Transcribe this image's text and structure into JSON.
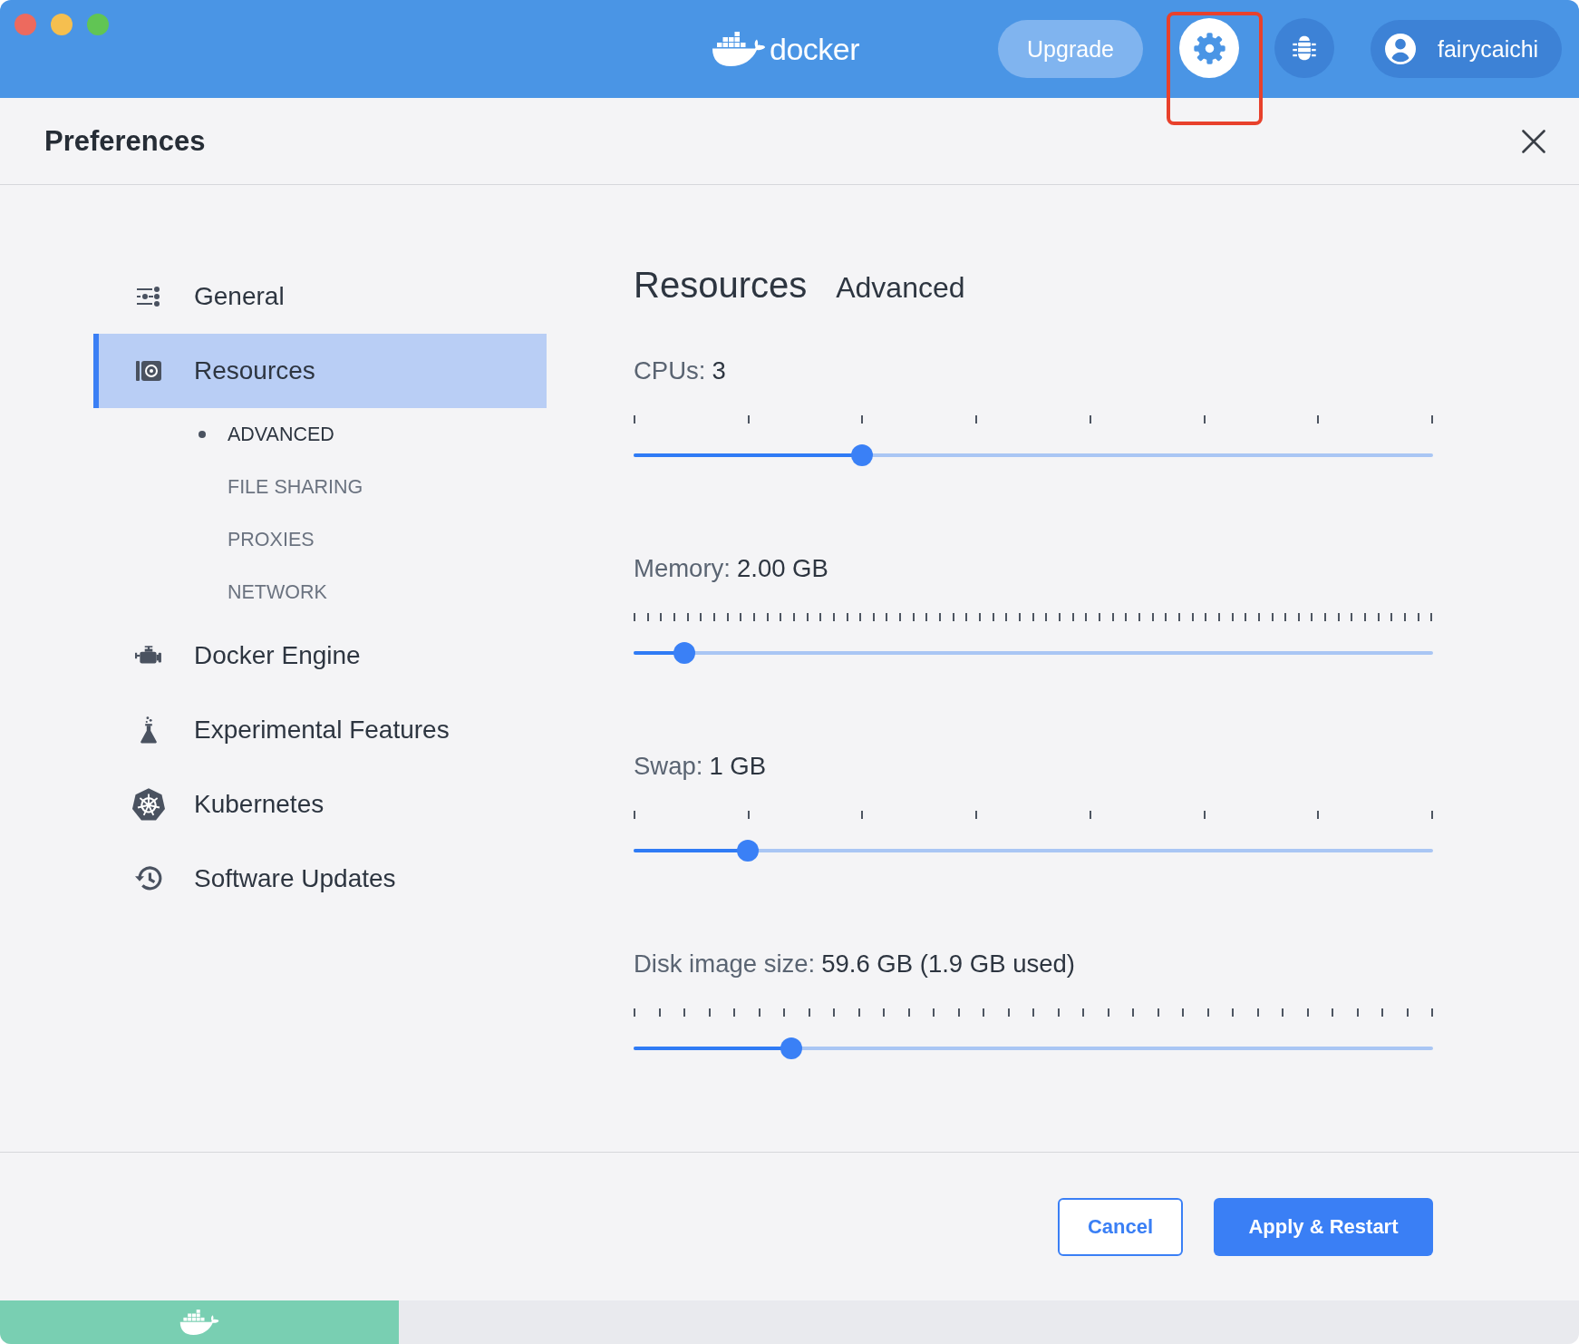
{
  "toolbar": {
    "logo": "docker",
    "upgrade": "Upgrade",
    "icon_buttons": [
      {
        "kind": "settings",
        "selected": true,
        "highlighted": true
      },
      {
        "kind": "bug",
        "selected": false,
        "highlighted": false
      }
    ],
    "account": {
      "username": "fairycaichi"
    }
  },
  "header": {
    "title": "Preferences"
  },
  "sidebar": {
    "items": [
      {
        "kind": "general",
        "label": "General",
        "selected": false
      },
      {
        "kind": "resources",
        "label": "Resources",
        "selected": true,
        "children": [
          {
            "label": "ADVANCED",
            "selected": true
          },
          {
            "label": "FILE SHARING",
            "selected": false
          },
          {
            "label": "PROXIES",
            "selected": false
          },
          {
            "label": "NETWORK",
            "selected": false
          }
        ]
      },
      {
        "kind": "engine",
        "label": "Docker Engine",
        "selected": false
      },
      {
        "kind": "experimental",
        "label": "Experimental Features",
        "selected": false
      },
      {
        "kind": "kubernetes",
        "label": "Kubernetes",
        "selected": false
      },
      {
        "kind": "updates",
        "label": "Software Updates",
        "selected": false
      }
    ]
  },
  "content": {
    "title": "Resources",
    "subtitle": "Advanced",
    "sliders": [
      {
        "kind": "coarse",
        "label": "CPUs:",
        "value": "3",
        "level": 0.286
      },
      {
        "kind": "fine",
        "label": "Memory:",
        "value": "2.00 GB",
        "level": 0.064
      },
      {
        "kind": "coarse",
        "label": "Swap:",
        "value": "1 GB",
        "level": 0.143
      },
      {
        "kind": "medium",
        "label": "Disk image size:",
        "value": "59.6 GB (1.9 GB used)",
        "level": 0.197
      }
    ]
  },
  "footer": {
    "buttons": [
      {
        "kind": "secondary",
        "label": "Cancel"
      },
      {
        "kind": "primary",
        "label": "Apply & Restart"
      }
    ]
  }
}
